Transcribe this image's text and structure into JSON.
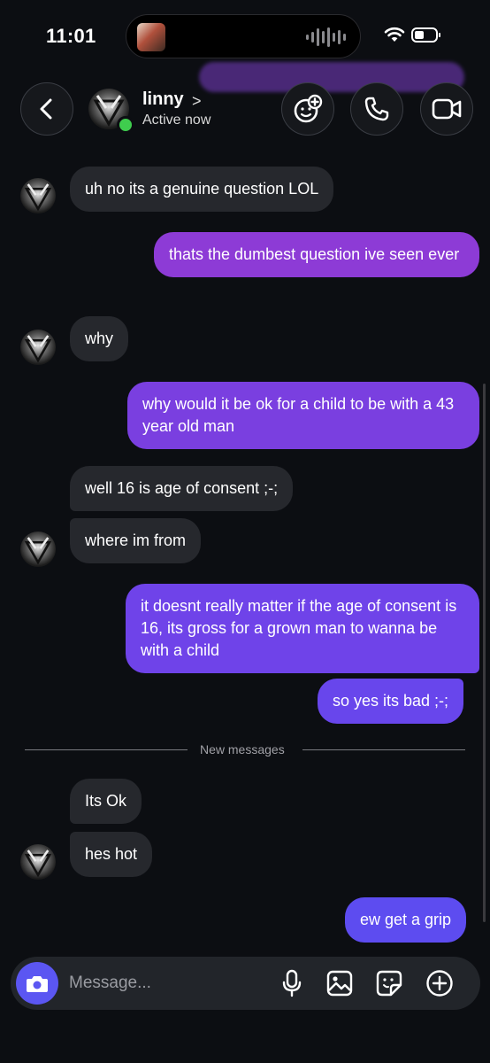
{
  "status_bar": {
    "time": "11:01"
  },
  "header": {
    "contact_name": "linny",
    "status": "Active now",
    "name_chevron": ">"
  },
  "messages": [
    {
      "direction": "incoming",
      "text": "uh no its a genuine question LOL"
    },
    {
      "direction": "outgoing",
      "text": "thats the dumbest question ive seen ever"
    },
    {
      "direction": "incoming",
      "text": "why"
    },
    {
      "direction": "outgoing",
      "text": "why would it be ok for a child to be with a 43 year old man"
    },
    {
      "direction": "incoming",
      "text": "well 16 is age of consent ;-;"
    },
    {
      "direction": "incoming",
      "text": "where im from"
    },
    {
      "direction": "outgoing",
      "text": "it doesnt really matter if the age of consent is 16, its gross for a grown man to wanna be with a child"
    },
    {
      "direction": "outgoing",
      "text": "so yes its bad ;-;"
    },
    {
      "direction": "incoming",
      "text": "Its Ok"
    },
    {
      "direction": "incoming",
      "text": "hes hot"
    },
    {
      "direction": "outgoing",
      "text": "ew get a grip"
    }
  ],
  "divider": {
    "label": "New messages"
  },
  "composer": {
    "placeholder": "Message..."
  },
  "icons": {
    "back": "chevron-left-icon",
    "effects": "face-sparkle-icon",
    "call": "phone-icon",
    "video": "video-camera-icon",
    "camera": "camera-icon",
    "mic": "microphone-icon",
    "gallery": "image-icon",
    "sticker": "sticker-icon",
    "add": "plus-circle-icon"
  },
  "colors": {
    "background": "#0c0e12",
    "incoming_bubble": "#26282d",
    "outgoing_top": "#8d3bd6",
    "outgoing_bottom": "#5d4cf0",
    "online": "#3fcd4e",
    "camera_button": "#5b56f2"
  }
}
